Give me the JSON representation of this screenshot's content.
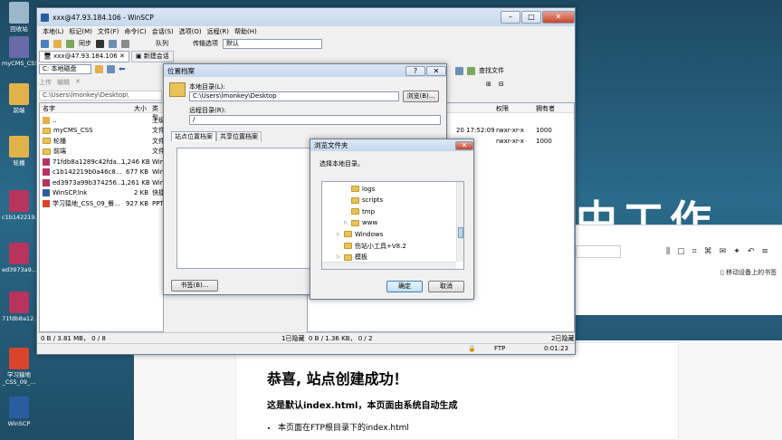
{
  "desktop": {
    "icons": [
      {
        "label": "回收站",
        "color": "#9bb7c9"
      },
      {
        "label": "myCMS_CSS",
        "color": "#6a6aa8"
      },
      {
        "label": "前端",
        "color": "#e2b24a"
      },
      {
        "label": "轮播",
        "color": "#e2b24a"
      },
      {
        "label": "c1b142219...",
        "color": "#b8345c"
      },
      {
        "label": "ed3973a9...",
        "color": "#b8345c"
      },
      {
        "label": "71fdb8a12...",
        "color": "#b8345c"
      },
      {
        "label": "学习猿地_CSS_09_...",
        "color": "#d9442a"
      },
      {
        "label": "WinSCP",
        "color": "#2a5d9f"
      }
    ]
  },
  "background_page": {
    "big_text": "中工作",
    "card_title": "恭喜, 站点创建成功！",
    "card_subtitle": "这是默认index.html，本页面由系统自动生成",
    "bullet": "本页面在FTP根目录下的index.html",
    "bookmark_text": "移动设备上的书签"
  },
  "winscp": {
    "title": "xxx@47.93.184.106 - WinSCP",
    "menu": [
      "本地(L)",
      "标记(M)",
      "文件(F)",
      "命令(C)",
      "会话(S)",
      "选项(O)",
      "远程(R)",
      "帮助(H)"
    ],
    "toolbar": {
      "sync": "同步",
      "queue": "队列",
      "transfer_label": "传输选项",
      "transfer_value": "默认"
    },
    "tabs": {
      "session": "xxx@47.93.184.106",
      "new_session": "新建会话"
    },
    "local": {
      "drive": "C: 本地磁盘",
      "upload": "上传",
      "edit": "编辑",
      "path": "C:\\Users\\lmonkey\\Desktop\\",
      "columns": [
        "名字",
        "大小",
        "类型"
      ],
      "rows": [
        {
          "name": "..",
          "size": "",
          "type": "上级",
          "icon": "up"
        },
        {
          "name": "myCMS_CSS",
          "size": "",
          "type": "文件",
          "icon": "folder"
        },
        {
          "name": "轮播",
          "size": "",
          "type": "文件",
          "icon": "folder"
        },
        {
          "name": "前端",
          "size": "",
          "type": "文件",
          "icon": "folder"
        },
        {
          "name": "71fdb8a1289c42fda...",
          "size": "1,246 KB",
          "type": "Win",
          "icon": "rar"
        },
        {
          "name": "c1b142219b0a46c8...",
          "size": "677 KB",
          "type": "Win",
          "icon": "rar"
        },
        {
          "name": "ed3973a99b374256...",
          "size": "1,261 KB",
          "type": "Win",
          "icon": "rar"
        },
        {
          "name": "WinSCP.lnk",
          "size": "2 KB",
          "type": "快捷",
          "icon": "lnk"
        },
        {
          "name": "学习猿地_CSS_09_餐...",
          "size": "927 KB",
          "type": "PPT",
          "icon": "ppt"
        }
      ],
      "status": "0 B / 3.81 MB， 0 / 8",
      "hidden": "1已隐藏"
    },
    "remote": {
      "find": "查找文件",
      "columns": [
        "权限",
        "拥有者"
      ],
      "rows": [
        {
          "time": "20 17:52:09",
          "perm": "rwxr-xr-x",
          "owner": "1000"
        },
        {
          "time": "",
          "perm": "rwxr-xr-x",
          "owner": "1000"
        }
      ],
      "status": "0 B / 1.36 KB， 0 / 2",
      "hidden": "2已隐藏",
      "protocol": "FTP",
      "time": "0:01:23"
    }
  },
  "location_dialog": {
    "title": "位置档案",
    "local_label": "本地目录(L):",
    "local_value": "C:\\Users\\lmonkey\\Desktop",
    "browse": "浏览(B)...",
    "remote_label": "远程目录(R):",
    "remote_value": "/",
    "tab_site": "站点位置档案",
    "tab_shared": "共享位置档案",
    "bookmark": "书签(B)..."
  },
  "browse_dialog": {
    "title": "浏览文件夹",
    "prompt": "选择本地目录。",
    "tree": [
      {
        "label": "logs",
        "indent": 2,
        "arrow": ""
      },
      {
        "label": "scripts",
        "indent": 2,
        "arrow": ""
      },
      {
        "label": "tmp",
        "indent": 2,
        "arrow": ""
      },
      {
        "label": "www",
        "indent": 2,
        "arrow": "▷"
      },
      {
        "label": "Windows",
        "indent": 1,
        "arrow": "▷"
      },
      {
        "label": "伤站小工具+V8.2",
        "indent": 1,
        "arrow": ""
      },
      {
        "label": "模板",
        "indent": 1,
        "arrow": "▷"
      }
    ],
    "ok": "确定",
    "cancel": "取消"
  }
}
